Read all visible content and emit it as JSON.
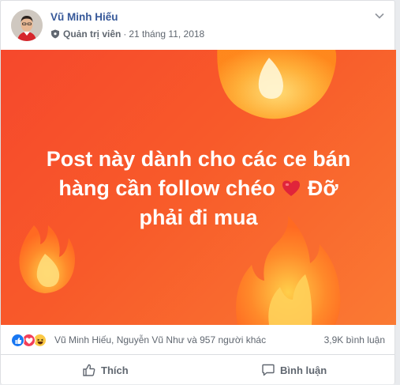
{
  "post": {
    "author": "Vũ Minh Hiếu",
    "role": "Quản trị viên",
    "date": "21 tháng 11, 2018",
    "text_line1": "Post này dành cho các ce bán",
    "text_line2a": "hàng cần follow chéo",
    "text_line2b": "Đỡ",
    "text_line3": "phải đi mua",
    "background_color": "#f6482c"
  },
  "reactions": {
    "names": "Vũ Minh Hiếu, Nguyễn Vũ Như và 957 người khác",
    "comments": "3,9K bình luận",
    "icons": [
      "like-icon",
      "love-icon",
      "haha-icon"
    ]
  },
  "actions": {
    "like_label": "Thích",
    "comment_label": "Bình luận"
  },
  "colors": {
    "author_link": "#365899",
    "meta_text": "#606770",
    "like_blue": "#1877f2",
    "love_red": "#f33e58",
    "haha_yellow": "#fcc945"
  }
}
